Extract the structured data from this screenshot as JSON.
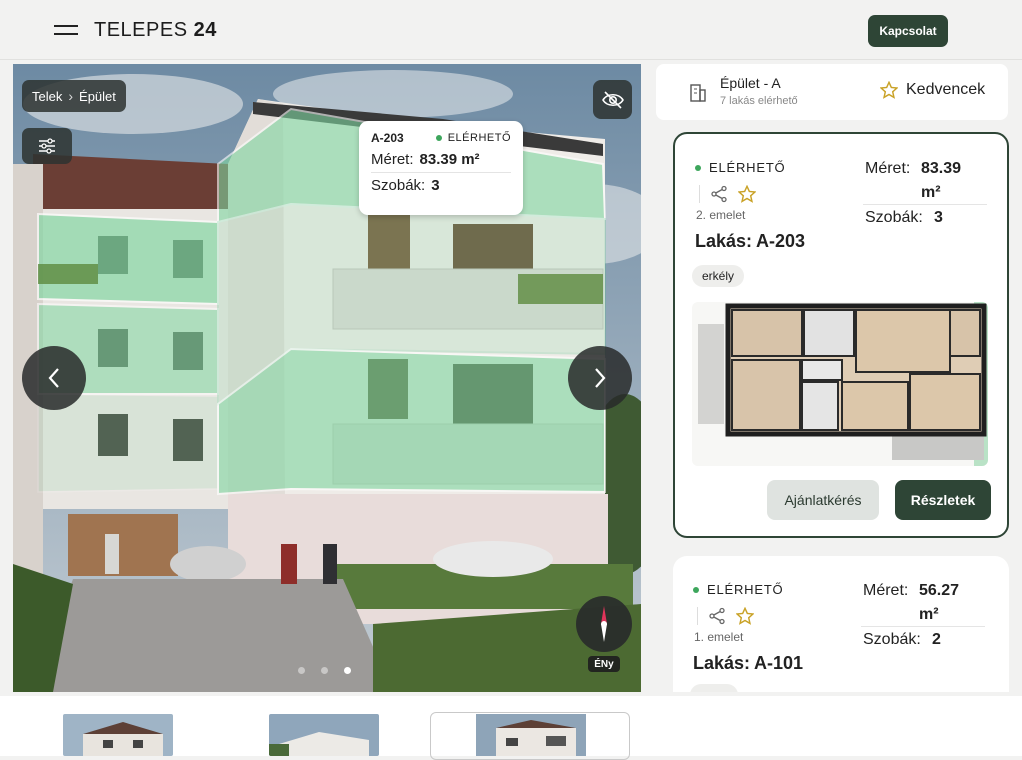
{
  "header": {
    "logo_text": "TELEPES",
    "logo_number": "24",
    "contact_label": "Kapcsolat"
  },
  "viewer": {
    "breadcrumb": [
      "Telek",
      "Épület"
    ],
    "tooltip": {
      "unit": "A-203",
      "status": "ELÉRHETŐ",
      "size_label": "Méret:",
      "size_value": "83.39 m²",
      "rooms_label": "Szobák:",
      "rooms_value": "3"
    },
    "compass_label": "ÉNy",
    "slide_count": 3,
    "active_slide": 3
  },
  "panel": {
    "building_title": "Épület - A",
    "building_sub": "7 lakás elérhető",
    "favorites_label": "Kedvencek",
    "cards": [
      {
        "status": "ELÉRHETŐ",
        "floor": "2. emelet",
        "unit_label": "Lakás:",
        "unit": "A-203",
        "size_label": "Méret:",
        "size_value": "83.39",
        "size_unit": "m²",
        "rooms_label": "Szobák:",
        "rooms_value": "3",
        "tag": "erkély",
        "offer_label": "Ajánlatkérés",
        "details_label": "Részletek"
      },
      {
        "status": "ELÉRHETŐ",
        "floor": "1. emelet",
        "unit_label": "Lakás:",
        "unit": "A-101",
        "size_label": "Méret:",
        "size_value": "56.27",
        "size_unit": "m²",
        "rooms_label": "Szobák:",
        "rooms_value": "2"
      }
    ]
  },
  "colors": {
    "brand": "#2e4536",
    "available": "#3da65c",
    "highlight": "#7fd6a0"
  }
}
